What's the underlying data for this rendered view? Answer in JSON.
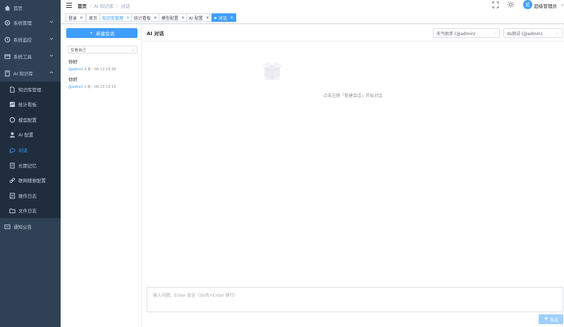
{
  "sidebar": {
    "items": [
      {
        "label": "首页",
        "icon": "home-icon"
      },
      {
        "label": "系统管理",
        "icon": "gear-icon"
      },
      {
        "label": "系统监控",
        "icon": "monitor-icon"
      },
      {
        "label": "系统工具",
        "icon": "tools-icon"
      },
      {
        "label": "AI 知识库",
        "icon": "book-icon"
      },
      {
        "label": "知识库管理",
        "icon": "document-icon"
      },
      {
        "label": "统计看板",
        "icon": "dashboard-icon"
      },
      {
        "label": "模型配置",
        "icon": "model-icon"
      },
      {
        "label": "AI 配置",
        "icon": "user-icon"
      },
      {
        "label": "对话",
        "icon": "chat-icon"
      },
      {
        "label": "长期记忆",
        "icon": "memory-icon"
      },
      {
        "label": "联网搜索配置",
        "icon": "link-icon"
      },
      {
        "label": "操作日志",
        "icon": "log-icon"
      },
      {
        "label": "文件日志",
        "icon": "folder-icon"
      },
      {
        "label": "通知公告",
        "icon": "notice-icon"
      }
    ]
  },
  "navbar": {
    "breadcrumb": [
      "首页",
      "AI 知识库",
      "对话"
    ],
    "username": "超级管理员",
    "avatar_text": "超"
  },
  "tags": [
    {
      "label": "登录"
    },
    {
      "label": "首页"
    },
    {
      "label": "知识库管理"
    },
    {
      "label": "统计看板"
    },
    {
      "label": "模型配置"
    },
    {
      "label": "AI 配置"
    },
    {
      "label": "对话"
    }
  ],
  "conversations": {
    "new_button": "新建会话",
    "filter": "仅看自己",
    "items": [
      {
        "title": "你好",
        "author": "@admin",
        "meta": "4 条 · 06-13 23:38"
      },
      {
        "title": "你好",
        "author": "@admin",
        "meta": "2 条 · 06-13 23:19"
      }
    ]
  },
  "chat": {
    "title": "AI 对话",
    "assistant_select": "天气助手 (@admin)",
    "model_select": "ds测试 (@admin)",
    "empty_text": "点击左侧「新建会话」开始对话",
    "input_placeholder": "输入问题，Enter 发送（Shift+Enter 换行）",
    "send_label": "发送"
  },
  "colors": {
    "accent": "#409eff",
    "sidebar_bg": "#304156",
    "submenu_bg": "#1f2d3d"
  }
}
